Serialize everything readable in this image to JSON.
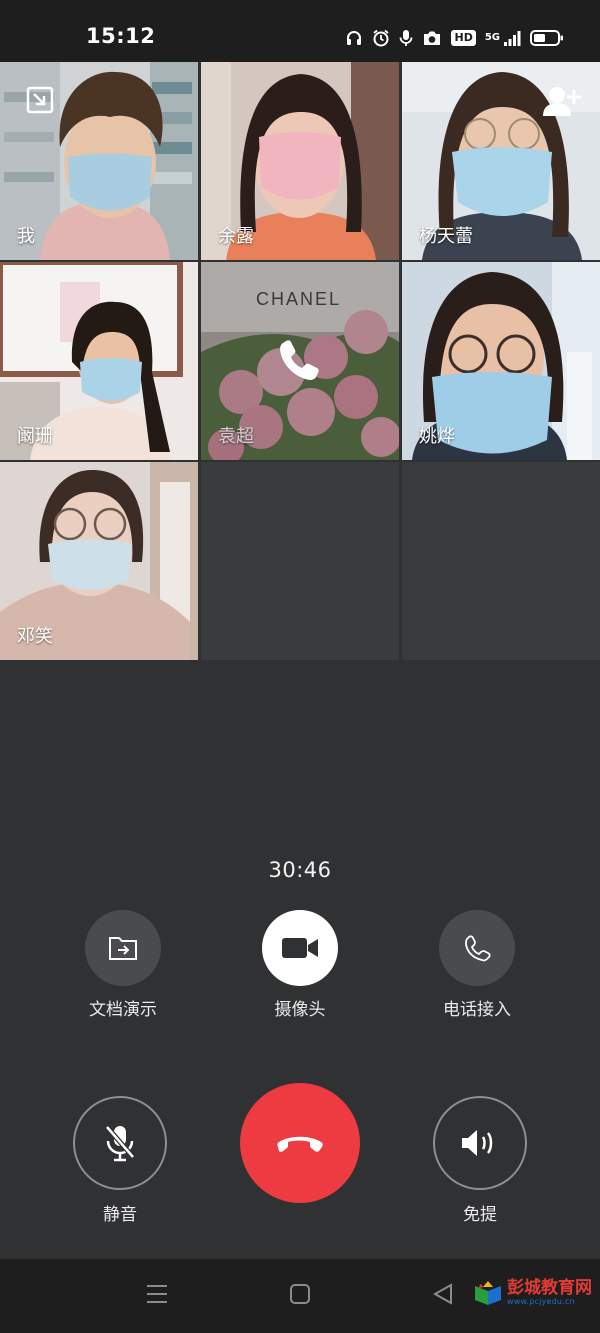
{
  "status_bar": {
    "time": "15:12",
    "network": "5G",
    "hd_badge": "HD",
    "icons": [
      "headset-icon",
      "alarm-icon",
      "microphone-icon",
      "camera-icon",
      "hd-icon",
      "signal-icon",
      "battery-icon"
    ]
  },
  "participants": [
    {
      "name": "我"
    },
    {
      "name": "余露"
    },
    {
      "name": "杨天蕾"
    },
    {
      "name": "阚珊"
    },
    {
      "name": "袁超",
      "state": "calling"
    },
    {
      "name": "姚烨"
    },
    {
      "name": "邓笑"
    }
  ],
  "call": {
    "timer": "30:46"
  },
  "actions": {
    "share_document": "文档演示",
    "camera": "摄像头",
    "phone_dial_in": "电话接入",
    "mute": "静音",
    "speaker": "免提"
  },
  "watermark": {
    "title": "彭城教育网",
    "url": "www.pcjyedu.cn"
  },
  "colors": {
    "background": "#303133",
    "hangup": "#ee3b41",
    "empty_tile": "#3a3b3d"
  }
}
